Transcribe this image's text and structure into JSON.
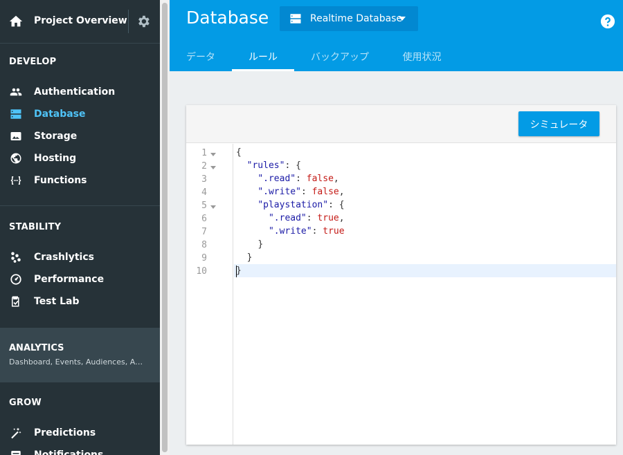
{
  "sidebar": {
    "overview_label": "Project Overview",
    "sections": {
      "develop": "DEVELOP",
      "stability": "STABILITY",
      "analytics": "ANALYTICS",
      "analytics_sub": "Dashboard, Events, Audiences, At...",
      "grow": "GROW"
    },
    "items": {
      "authentication": "Authentication",
      "database": "Database",
      "storage": "Storage",
      "hosting": "Hosting",
      "functions": "Functions",
      "crashlytics": "Crashlytics",
      "performance": "Performance",
      "testlab": "Test Lab",
      "predictions": "Predictions",
      "notifications": "Notifications"
    },
    "active_item": "Database",
    "colors": {
      "background": "#263238",
      "active": "#4fc3f7"
    }
  },
  "header": {
    "title": "Database",
    "db_selector": "Realtime Database",
    "tabs": [
      "データ",
      "ルール",
      "バックアップ",
      "使用状況"
    ],
    "active_tab": "ルール",
    "color": "#039be5"
  },
  "editor": {
    "simulator_button": "シミュレータ",
    "line_numbers": [
      "1",
      "2",
      "3",
      "4",
      "5",
      "6",
      "7",
      "8",
      "9",
      "10"
    ],
    "lines": [
      {
        "p": "{"
      },
      {
        "a": "\"rules\"",
        "b": ": {",
        "indent": "  "
      },
      {
        "a": "\".read\"",
        "b": ": ",
        "c": "false",
        "d": ",",
        "indent": "    "
      },
      {
        "a": "\".write\"",
        "b": ": ",
        "c": "false",
        "d": ",",
        "indent": "    "
      },
      {
        "a": "\"playstation\"",
        "b": ": {",
        "indent": "    "
      },
      {
        "a": "\".read\"",
        "b": ": ",
        "c": "true",
        "d": ",",
        "indent": "      "
      },
      {
        "a": "\".write\"",
        "b": ": ",
        "c": "true",
        "indent": "      "
      },
      {
        "p": "}",
        "indent": "    "
      },
      {
        "p": "}",
        "indent": "  "
      },
      {
        "p": "}"
      }
    ],
    "highlighted_line": 10
  }
}
